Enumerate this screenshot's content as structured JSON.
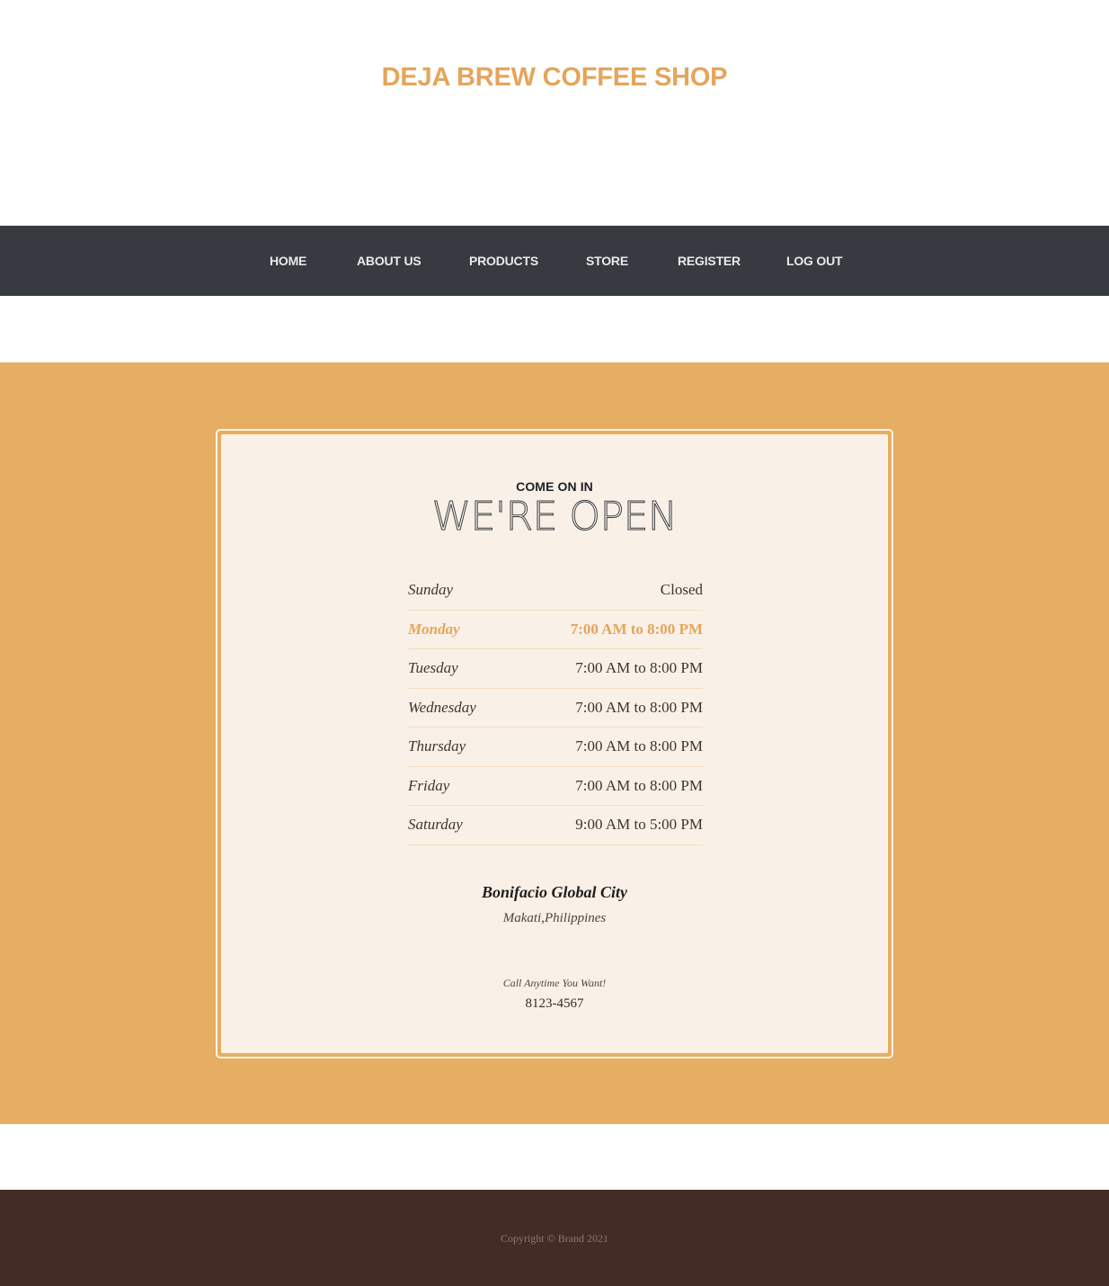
{
  "brand": {
    "title": "DEJA BREW COFFEE SHOP",
    "color": "#e4a55c"
  },
  "nav": {
    "items": [
      {
        "label": "HOME"
      },
      {
        "label": "ABOUT US"
      },
      {
        "label": "PRODUCTS"
      },
      {
        "label": "STORE"
      },
      {
        "label": "REGISTER"
      },
      {
        "label": "LOG OUT"
      }
    ]
  },
  "hours_card": {
    "subheading": "COME ON IN",
    "heading": "WE'RE OPEN",
    "rows": [
      {
        "day": "Sunday",
        "time": "Closed"
      },
      {
        "day": "Monday",
        "time": "7:00 AM to 8:00 PM",
        "highlighted": true
      },
      {
        "day": "Tuesday",
        "time": "7:00 AM to 8:00 PM"
      },
      {
        "day": "Wednesday",
        "time": "7:00 AM to 8:00 PM"
      },
      {
        "day": "Thursday",
        "time": "7:00 AM to 8:00 PM"
      },
      {
        "day": "Friday",
        "time": "7:00 AM to 8:00 PM"
      },
      {
        "day": "Saturday",
        "time": "9:00 AM to 5:00 PM"
      }
    ],
    "location_name": "Bonifacio Global City",
    "location_city": "Makati,Philippines",
    "call_label": "Call Anytime You Want!",
    "phone": "8123-4567"
  },
  "footer": {
    "copyright": "Copyright © Brand 2021"
  },
  "colors": {
    "accent": "#e6ae63",
    "nav_bg": "#373a40",
    "card_bg": "#f9f1e7",
    "footer_bg": "#432c26"
  }
}
